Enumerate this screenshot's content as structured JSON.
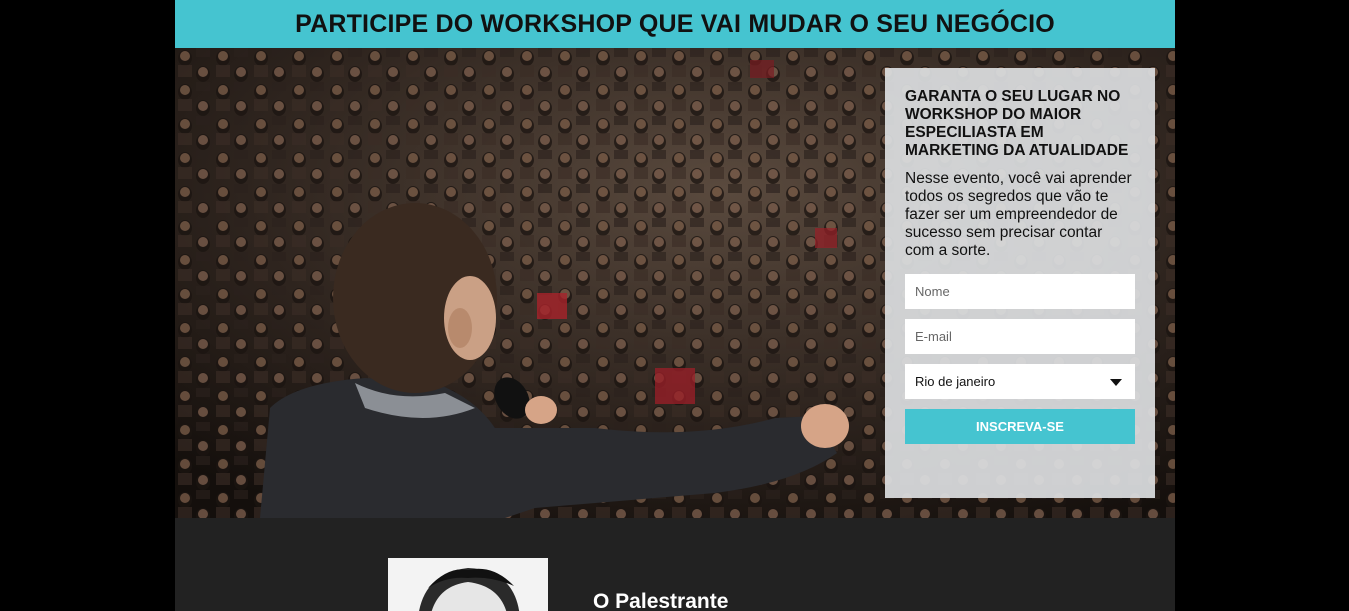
{
  "header": {
    "title": "PARTICIPE DO WORKSHOP QUE VAI MUDAR O SEU NEGÓCIO"
  },
  "hero": {
    "image": "speaker-with-microphone-audience-photo"
  },
  "form": {
    "heading": "GARANTA O SEU LUGAR NO WORKSHOP DO MAIOR ESPECILIASTA EM MARKETING DA ATUALIDADE",
    "description": "Nesse evento, você vai aprender todos os segredos que vão te fazer ser um empreendedor de sucesso sem precisar contar com a sorte.",
    "name_placeholder": "Nome",
    "email_placeholder": "E-mail",
    "city_selected": "Rio de janeiro",
    "submit_label": "INSCREVA-SE"
  },
  "speaker": {
    "title": "O Palestrante",
    "photo": "speaker-portrait-photo"
  },
  "colors": {
    "accent": "#45c4d0",
    "page_background": "#222222",
    "outer_background": "#000000"
  }
}
